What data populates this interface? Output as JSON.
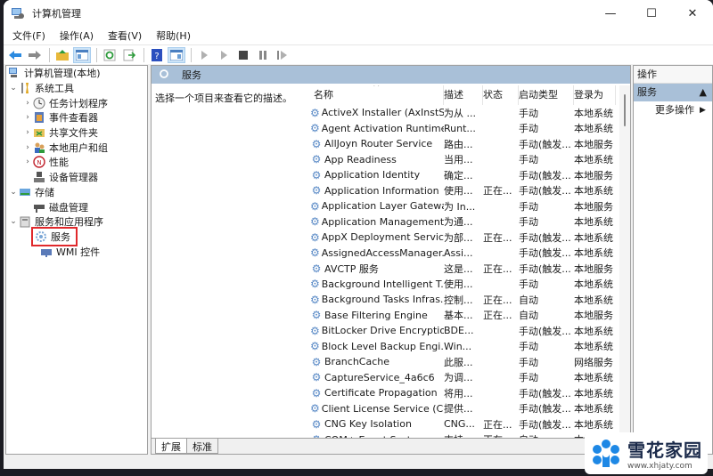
{
  "window": {
    "title": "计算机管理",
    "controls": {
      "minimize": "—",
      "maximize": "☐",
      "close": "✕"
    }
  },
  "menu": [
    "文件(F)",
    "操作(A)",
    "查看(V)",
    "帮助(H)"
  ],
  "toolbar": {
    "buttons": [
      "back-icon",
      "forward-icon",
      "up-folder-icon",
      "show-hide-console-tree-icon",
      "refresh-icon",
      "export-list-icon",
      "help-icon",
      "show-hide-action-pane-icon",
      "start-service-icon",
      "start-service-alt-icon",
      "stop-service-icon",
      "pause-service-icon",
      "restart-service-icon"
    ]
  },
  "tree": {
    "items": [
      {
        "label": "计算机管理(本地)",
        "level": 0,
        "chevron": "",
        "icon": "computer-management-icon"
      },
      {
        "label": "系统工具",
        "level": 1,
        "chevron": "expanded",
        "icon": "system-tools-icon"
      },
      {
        "label": "任务计划程序",
        "level": 2,
        "chevron": "collapsed",
        "icon": "task-scheduler-icon"
      },
      {
        "label": "事件查看器",
        "level": 2,
        "chevron": "collapsed",
        "icon": "event-viewer-icon"
      },
      {
        "label": "共享文件夹",
        "level": 2,
        "chevron": "collapsed",
        "icon": "shared-folders-icon"
      },
      {
        "label": "本地用户和组",
        "level": 2,
        "chevron": "collapsed",
        "icon": "local-users-icon"
      },
      {
        "label": "性能",
        "level": 2,
        "chevron": "collapsed",
        "icon": "performance-icon"
      },
      {
        "label": "设备管理器",
        "level": 2,
        "chevron": "",
        "icon": "device-manager-icon"
      },
      {
        "label": "存储",
        "level": 1,
        "chevron": "expanded",
        "icon": "storage-icon"
      },
      {
        "label": "磁盘管理",
        "level": 2,
        "chevron": "",
        "icon": "disk-management-icon"
      },
      {
        "label": "服务和应用程序",
        "level": 1,
        "chevron": "expanded",
        "icon": "services-apps-icon"
      },
      {
        "label": "服务",
        "level": 2,
        "chevron": "",
        "icon": "services-icon",
        "selected": true
      },
      {
        "label": "WMI 控件",
        "level": 2,
        "chevron": "",
        "icon": "wmi-control-icon"
      }
    ]
  },
  "center": {
    "header": "服务",
    "description": "选择一个项目来查看它的描述。",
    "columns": [
      "名称",
      "描述",
      "状态",
      "启动类型",
      "登录为"
    ],
    "rows": [
      [
        "ActiveX Installer (AxInstSV)",
        "为从 ...",
        "",
        "手动",
        "本地系统"
      ],
      [
        "Agent Activation Runtime...",
        "Runt...",
        "",
        "手动",
        "本地系统"
      ],
      [
        "AllJoyn Router Service",
        "路由...",
        "",
        "手动(触发...",
        "本地服务"
      ],
      [
        "App Readiness",
        "当用...",
        "",
        "手动",
        "本地系统"
      ],
      [
        "Application Identity",
        "确定...",
        "",
        "手动(触发...",
        "本地服务"
      ],
      [
        "Application Information",
        "使用...",
        "正在...",
        "手动(触发...",
        "本地系统"
      ],
      [
        "Application Layer Gatewa...",
        "为 In...",
        "",
        "手动",
        "本地服务"
      ],
      [
        "Application Management",
        "为通...",
        "",
        "手动",
        "本地系统"
      ],
      [
        "AppX Deployment Servic...",
        "为部...",
        "正在...",
        "手动(触发...",
        "本地系统"
      ],
      [
        "AssignedAccessManager...",
        "Assi...",
        "",
        "手动(触发...",
        "本地系统"
      ],
      [
        "AVCTP 服务",
        "这是...",
        "正在...",
        "手动(触发...",
        "本地服务"
      ],
      [
        "Background Intelligent T...",
        "使用...",
        "",
        "手动",
        "本地系统"
      ],
      [
        "Background Tasks Infras...",
        "控制...",
        "正在...",
        "自动",
        "本地系统"
      ],
      [
        "Base Filtering Engine",
        "基本...",
        "正在...",
        "自动",
        "本地服务"
      ],
      [
        "BitLocker Drive Encryptio...",
        "BDE...",
        "",
        "手动(触发...",
        "本地系统"
      ],
      [
        "Block Level Backup Engi...",
        "Win...",
        "",
        "手动",
        "本地系统"
      ],
      [
        "BranchCache",
        "此服...",
        "",
        "手动",
        "网络服务"
      ],
      [
        "CaptureService_4a6c6",
        "为调...",
        "",
        "手动",
        "本地系统"
      ],
      [
        "Certificate Propagation",
        "将用...",
        "",
        "手动(触发...",
        "本地系统"
      ],
      [
        "Client License Service (Cli...",
        "提供...",
        "",
        "手动(触发...",
        "本地系统"
      ],
      [
        "CNG Key Isolation",
        "CNG...",
        "正在...",
        "手动(触发...",
        "本地系统"
      ],
      [
        "COM+ Event System",
        "支持...",
        "正在...",
        "自动",
        "本地服务"
      ]
    ],
    "tabs": [
      "扩展",
      "标准"
    ],
    "active_tab": "扩展"
  },
  "actions": {
    "header": "操作",
    "section": "服务",
    "items": [
      "更多操作"
    ]
  },
  "watermark": {
    "name": "雪花家园",
    "url": "www.xhjaty.com"
  },
  "colors": {
    "header_blue": "#a9c0d8",
    "selection_red": "#e0292c"
  }
}
